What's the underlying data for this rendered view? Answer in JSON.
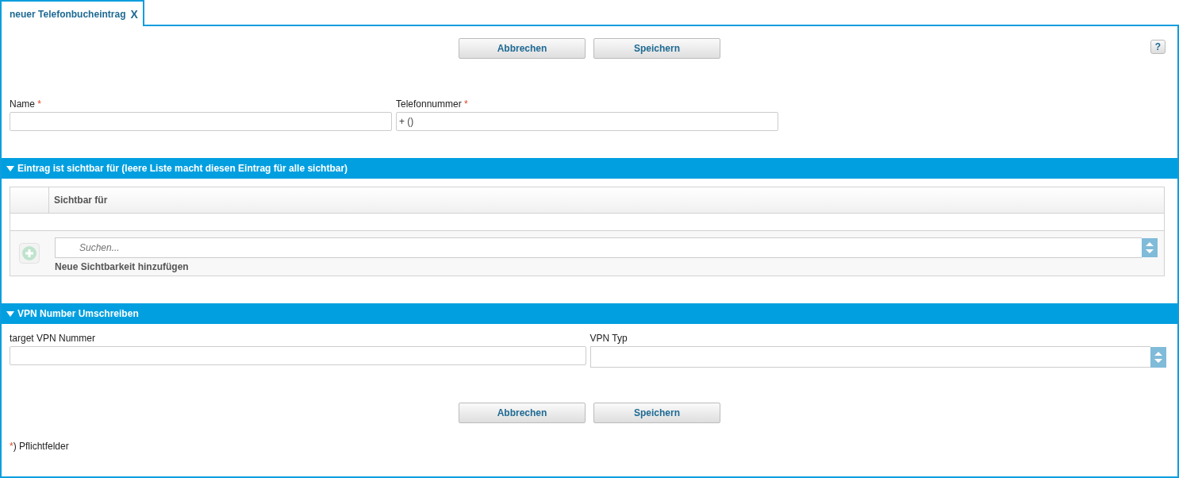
{
  "tabs": [
    {
      "label": "neuer Telefonbucheintrag",
      "close": "X",
      "selected": true
    }
  ],
  "top_buttons": [
    "Abbrechen",
    "Speichern"
  ],
  "help_button": "?",
  "fields": [
    {
      "label": "Name",
      "required_mark": "*"
    },
    {
      "label": "Telefonnummer",
      "required_mark": "*",
      "value": "+ ()"
    }
  ],
  "visibility_section": {
    "title": "Eintrag ist sichtbar für (leere Liste macht diesen Eintrag für alle sichtbar)",
    "expanded": true,
    "table": {
      "columns": [
        "Sichtbar für"
      ]
    },
    "search": {
      "placeholder": "Suchen..."
    },
    "add_label": "Neue Sichtbarkeit hinzufügen"
  },
  "vpn_section": {
    "title": "VPN Number Umschreiben",
    "expanded": true,
    "fields": [
      {
        "label": "target VPN Nummer",
        "kind": "text"
      },
      {
        "label": "VPN Typ",
        "kind": "select"
      }
    ]
  },
  "bottom_buttons": [
    "Abbrechen",
    "Speichern"
  ],
  "footnote": {
    "mark": "*",
    "text": ") Pflichtfelder"
  }
}
